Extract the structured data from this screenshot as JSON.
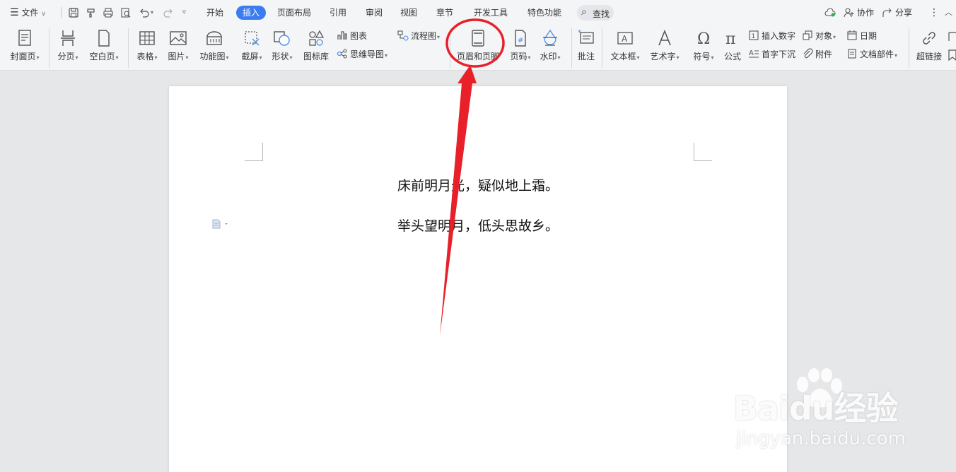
{
  "menubar": {
    "file": "文件",
    "tabs": [
      "开始",
      "插入",
      "页面布局",
      "引用",
      "审阅",
      "视图",
      "章节",
      "开发工具",
      "特色功能"
    ],
    "active_tab": "插入",
    "search": "查找",
    "collab": "协作",
    "share": "分享"
  },
  "ribbon": {
    "cover": "封面页",
    "page_break": "分页",
    "blank_page": "空白页",
    "table": "表格",
    "picture": "图片",
    "function_chart": "功能图",
    "screenshot": "截屏",
    "shapes": "形状",
    "icon_library": "图标库",
    "chart": "图表",
    "mindmap": "思维导图",
    "flowchart": "流程图",
    "header_footer": "页眉和页脚",
    "page_number": "页码",
    "watermark": "水印",
    "comment": "批注",
    "text_box": "文本框",
    "word_art": "艺术字",
    "symbol": "符号",
    "formula": "公式",
    "insert_number": "插入数字",
    "object": "对象",
    "date": "日期",
    "drop_cap": "首字下沉",
    "attachment": "附件",
    "doc_parts": "文档部件",
    "hyperlink": "超链接"
  },
  "document": {
    "lines": [
      "床前明月光，疑似地上霜。",
      "举头望明月，低头思故乡。"
    ]
  },
  "watermark": {
    "brand": "Baidu经验",
    "url": "jingyan.baidu.com"
  },
  "colors": {
    "accent": "#3c7cf0",
    "annotation_red": "#e8202a",
    "icon_gray": "#555555"
  }
}
